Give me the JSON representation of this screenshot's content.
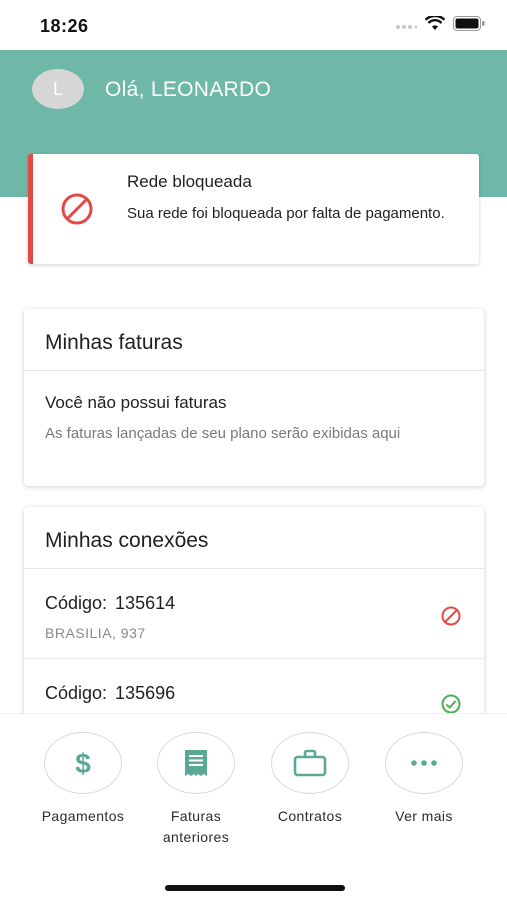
{
  "status_bar": {
    "time": "18:26"
  },
  "header": {
    "avatar_initial": "L",
    "greeting": "Olá, LEONARDO",
    "color": "#6fb8a7"
  },
  "alert": {
    "title": "Rede bloqueada",
    "message": "Sua rede foi bloqueada por falta de pagamento.",
    "accent": "#e34a45",
    "icon": "blocked-icon"
  },
  "invoices": {
    "title": "Minhas faturas",
    "empty_title": "Você não possui faturas",
    "empty_text": "As faturas lançadas de seu plano serão exibidas aqui"
  },
  "connections": {
    "title": "Minhas conexões",
    "code_label": "Código:",
    "items": [
      {
        "code": "135614",
        "address": "BRASILIA, 937",
        "status": "blocked",
        "status_color": "#e34a45"
      },
      {
        "code": "135696",
        "address": "",
        "status": "active",
        "status_color": "#4caf50"
      }
    ]
  },
  "nav": {
    "accent": "#5aa995",
    "items": [
      {
        "label": "Pagamentos",
        "icon": "dollar-icon"
      },
      {
        "label": "Faturas anteriores",
        "icon": "invoice-icon"
      },
      {
        "label": "Contratos",
        "icon": "briefcase-icon"
      },
      {
        "label": "Ver mais",
        "icon": "more-icon"
      }
    ]
  }
}
